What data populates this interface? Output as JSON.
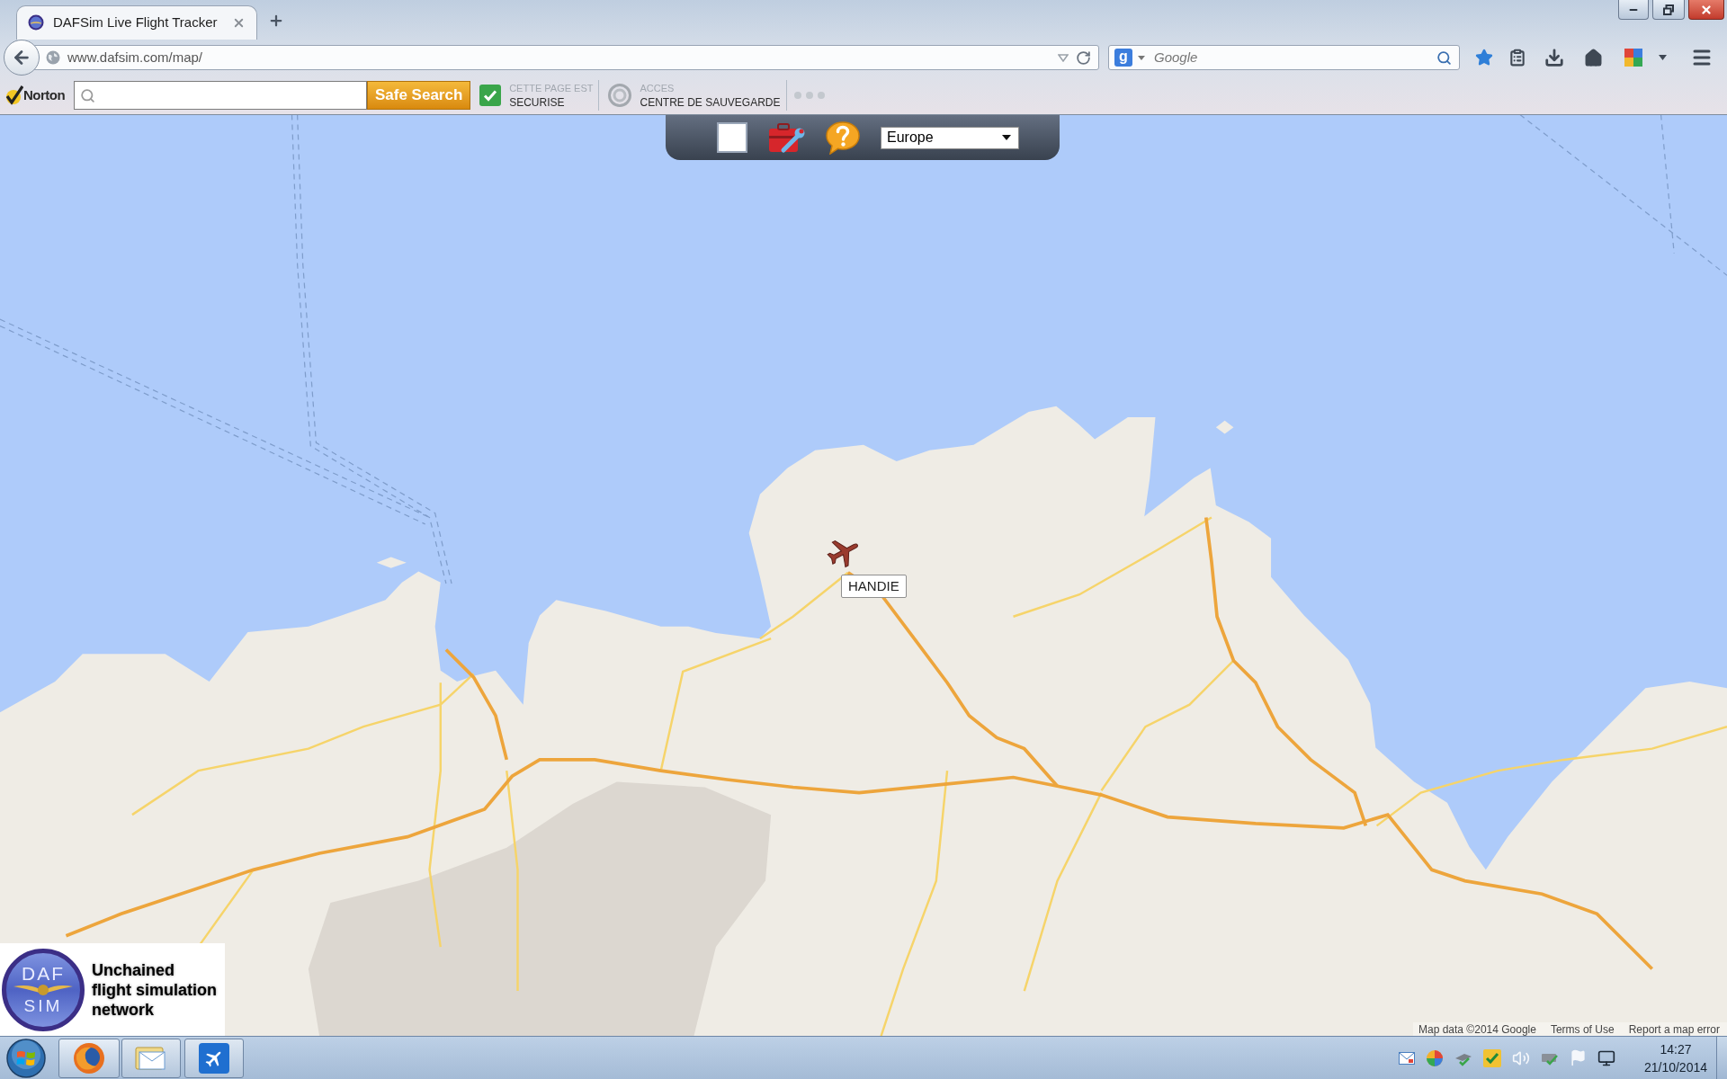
{
  "browser": {
    "tabs": [
      {
        "title": "DAFSim Live Flight Tracker",
        "selected": true
      }
    ],
    "address": {
      "value": "www.dafsim.com/map/"
    },
    "search": {
      "engine_letter": "g",
      "placeholder": "Google"
    },
    "bookmarked": true
  },
  "norton_toolbar": {
    "brand": "Norton",
    "search_button": "Safe Search",
    "status": [
      {
        "kind": "check",
        "caption": "CETTE PAGE EST",
        "value": "SECURISE"
      },
      {
        "kind": "ring",
        "caption": "ACCES",
        "value": "CENTRE DE SAUVEGARDE"
      }
    ]
  },
  "map_toolbar": {
    "region_select": {
      "value": "Europe"
    }
  },
  "map": {
    "aircraft": [
      {
        "label": "HANDIE"
      }
    ],
    "attribution": {
      "data": "Map data ©2014 Google",
      "links": [
        "Terms of Use",
        "Report a map error"
      ]
    }
  },
  "logo": {
    "top": "DAF",
    "bottom": "SIM",
    "tagline": [
      "Unchained",
      "flight simulation",
      "network"
    ]
  },
  "taskbar": {
    "clock": {
      "time": "14:27",
      "date": "21/10/2014"
    }
  }
}
